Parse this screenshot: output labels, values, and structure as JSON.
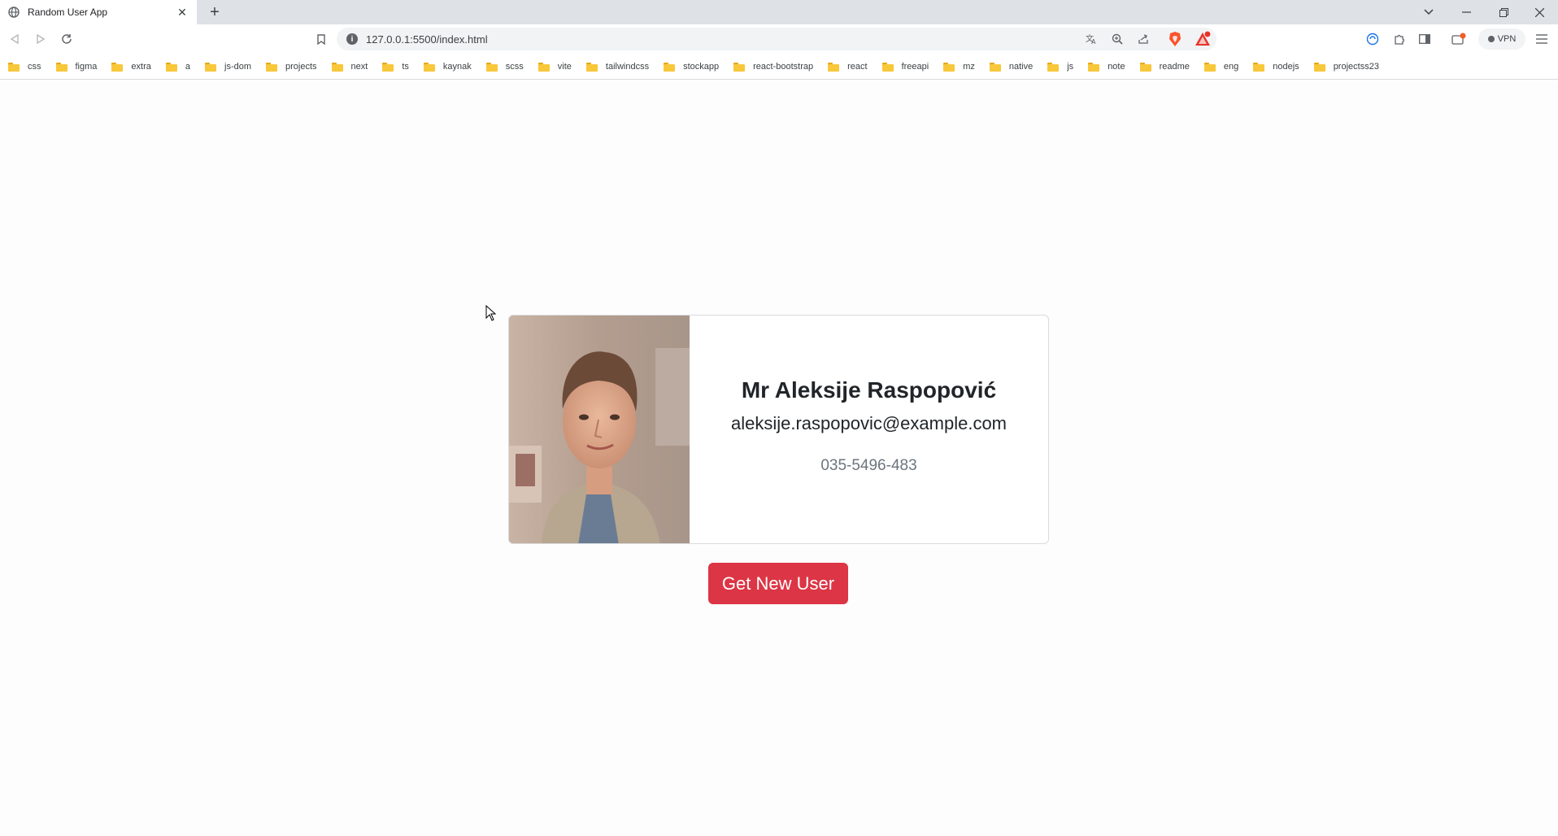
{
  "browser": {
    "tab": {
      "title": "Random User App"
    },
    "url": "127.0.0.1:5500/index.html",
    "vpn_label": "VPN",
    "bookmarks": [
      "css",
      "figma",
      "extra",
      "a",
      "js-dom",
      "projects",
      "next",
      "ts",
      "kaynak",
      "scss",
      "vite",
      "tailwindcss",
      "stockapp",
      "react-bootstrap",
      "react",
      "freeapi",
      "mz",
      "native",
      "js",
      "note",
      "readme",
      "eng",
      "nodejs",
      "projectss23"
    ]
  },
  "card": {
    "name": "Mr Aleksije Raspopović",
    "email": "aleksije.raspopovic@example.com",
    "phone": "035-5496-483"
  },
  "button": {
    "label": "Get New User"
  },
  "colors": {
    "button": "#dc3545",
    "phone_text": "#6c757d",
    "card_border": "#d9dbde"
  }
}
